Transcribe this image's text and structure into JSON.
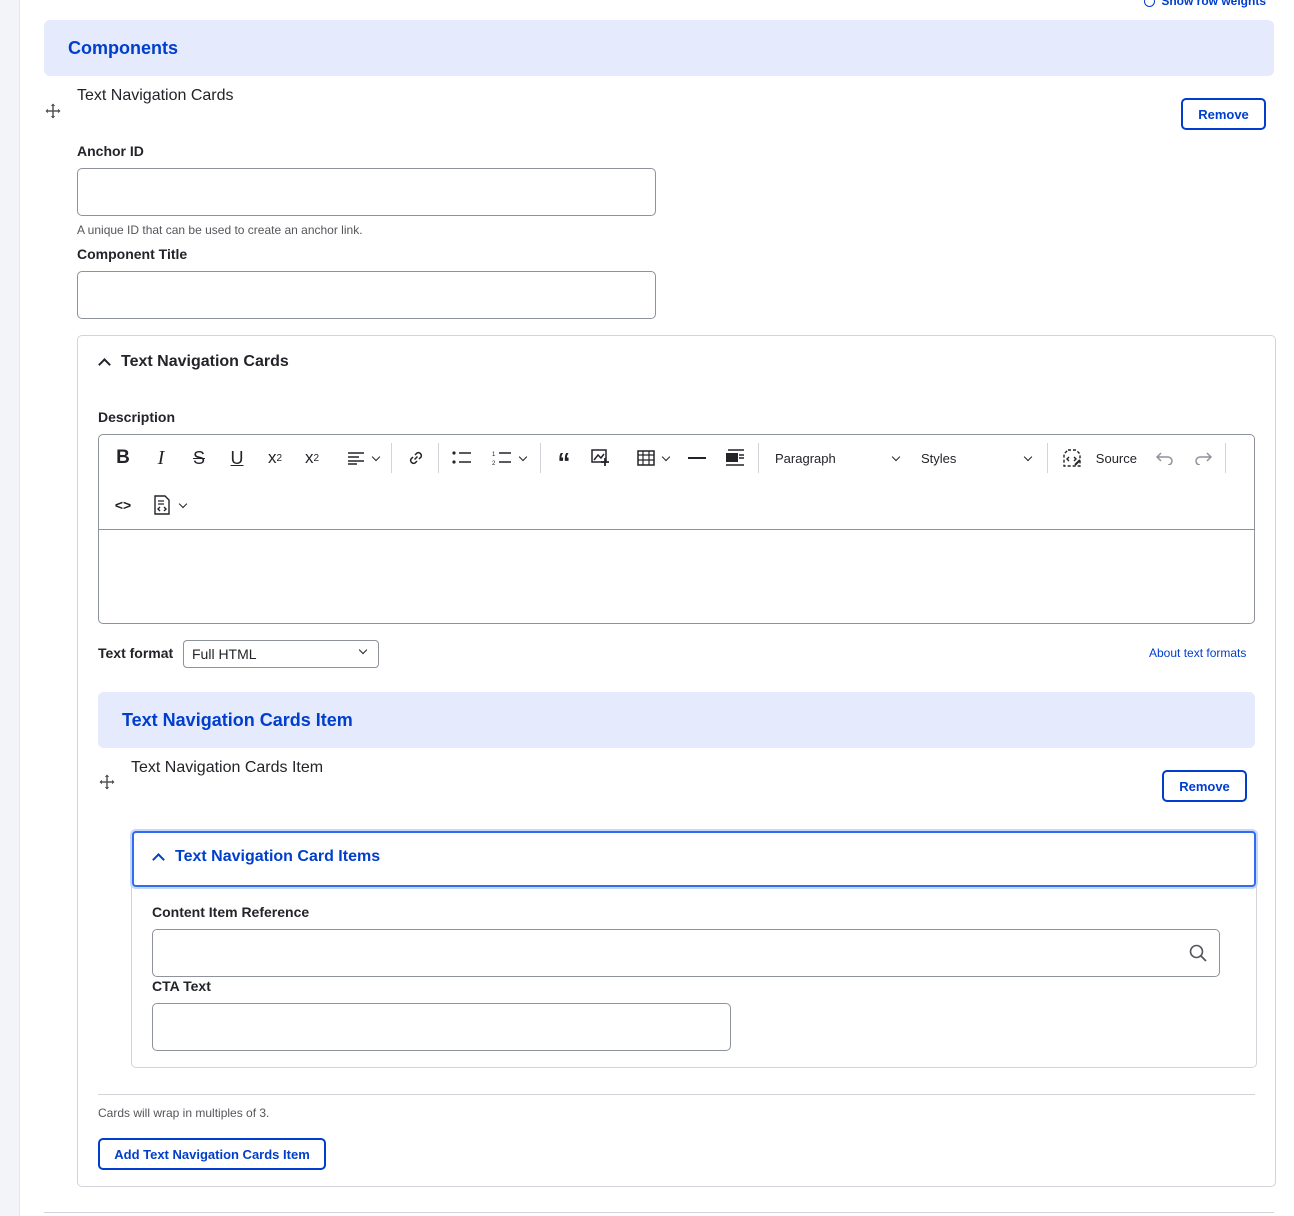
{
  "top_link": {
    "label": "Show row weights",
    "icon": "eye-icon"
  },
  "components": {
    "header": "Components",
    "item_title": "Text Navigation Cards",
    "remove_label": "Remove",
    "anchor": {
      "label": "Anchor ID",
      "value": "",
      "help": "A unique ID that can be used to create an anchor link."
    },
    "component_title": {
      "label": "Component Title",
      "value": ""
    }
  },
  "details": {
    "summary": "Text Navigation Cards",
    "description_label": "Description",
    "toolbar": {
      "paragraph": "Paragraph",
      "styles": "Styles",
      "source": "Source"
    },
    "text_format_label": "Text format",
    "text_format_value": "Full HTML",
    "about_formats": "About text formats",
    "items_header": "Text Navigation Cards Item",
    "item_title": "Text Navigation Cards Item",
    "item_remove_label": "Remove",
    "card_items": {
      "summary": "Text Navigation Card Items",
      "content_ref_label": "Content Item Reference",
      "content_ref_value": "",
      "cta_label": "CTA Text",
      "cta_value": ""
    },
    "wrap_help": "Cards will wrap in multiples of 3.",
    "add_button": "Add Text Navigation Cards Item"
  }
}
